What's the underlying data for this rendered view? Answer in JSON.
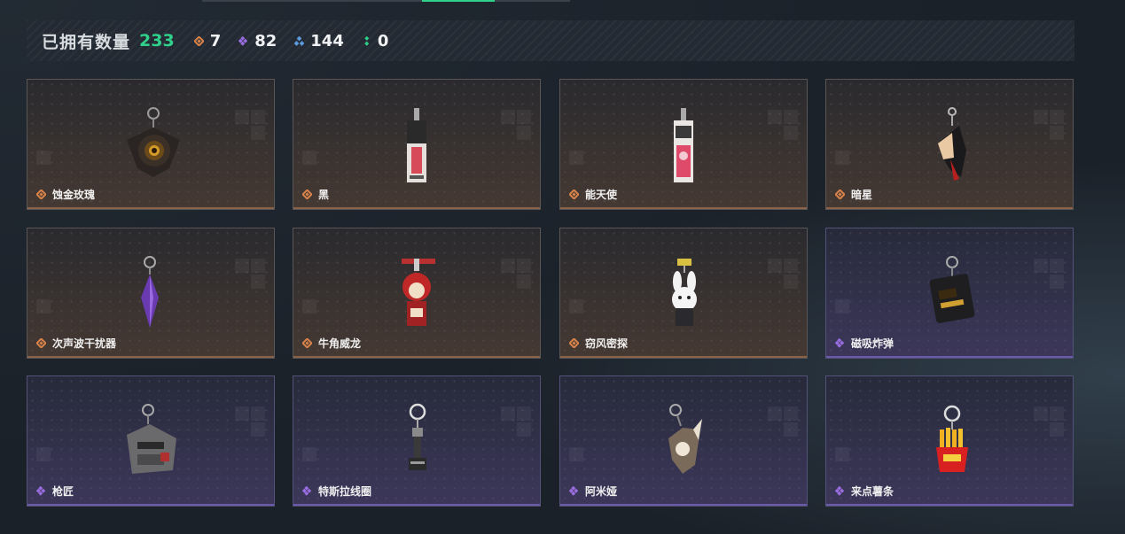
{
  "header": {
    "owned_label": "已拥有数量",
    "owned_count": "233",
    "stats": [
      {
        "icon": "orange-diamond-icon",
        "color": "#d9834a",
        "value": "7"
      },
      {
        "icon": "purple-diamond-icon",
        "color": "#9a6de0",
        "value": "82"
      },
      {
        "icon": "blue-diamond-icon",
        "color": "#5b9be0",
        "value": "144"
      },
      {
        "icon": "green-dots-icon",
        "color": "#2fd18b",
        "value": "0"
      }
    ]
  },
  "items": [
    {
      "name": "蚀金玫瑰",
      "tier": "orange",
      "art": "rose"
    },
    {
      "name": "黑",
      "tier": "orange",
      "art": "tag-black"
    },
    {
      "name": "能天使",
      "tier": "orange",
      "art": "tag-red"
    },
    {
      "name": "暗星",
      "tier": "orange",
      "art": "figure"
    },
    {
      "name": "次声波干扰器",
      "tier": "orange",
      "art": "crystal"
    },
    {
      "name": "牛角威龙",
      "tier": "orange",
      "art": "red-figure"
    },
    {
      "name": "窃风密探",
      "tier": "orange",
      "art": "bunny"
    },
    {
      "name": "磁吸炸弹",
      "tier": "purple",
      "art": "bomb"
    },
    {
      "name": "枪匠",
      "tier": "purple",
      "art": "toolbox"
    },
    {
      "name": "特斯拉线圈",
      "tier": "purple",
      "art": "coil"
    },
    {
      "name": "阿米娅",
      "tier": "purple",
      "art": "amiya"
    },
    {
      "name": "来点薯条",
      "tier": "purple",
      "art": "fries"
    }
  ]
}
